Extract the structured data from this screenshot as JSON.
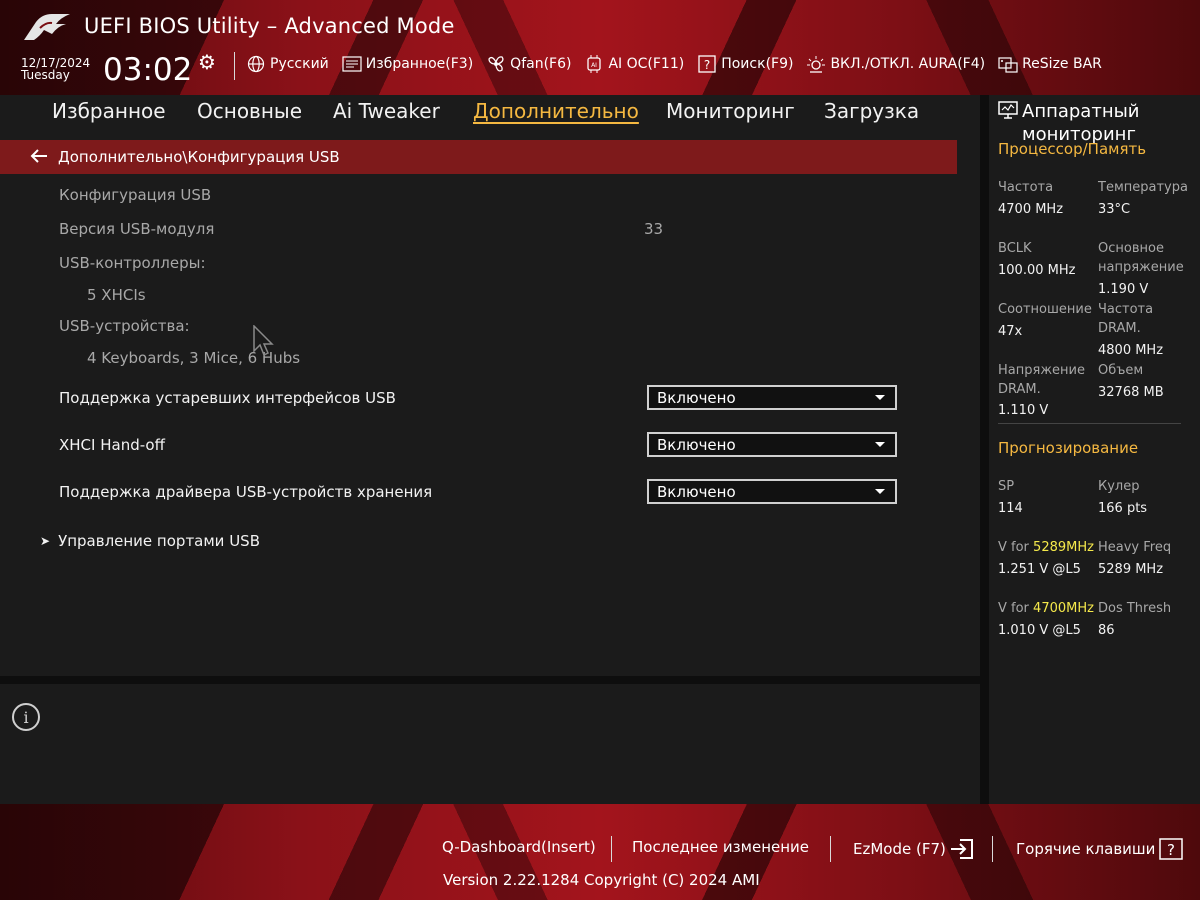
{
  "header": {
    "title": "UEFI BIOS Utility – Advanced Mode",
    "date": "12/17/2024",
    "weekday": "Tuesday",
    "time": "03:02",
    "toolbar": [
      {
        "label": "Русский",
        "icon": "globe-icon"
      },
      {
        "label": "Избранное(F3)",
        "icon": "favorites-icon"
      },
      {
        "label": "Qfan(F6)",
        "icon": "fan-icon"
      },
      {
        "label": "AI OC(F11)",
        "icon": "ai-chip-icon"
      },
      {
        "label": "Поиск(F9)",
        "icon": "search-help-icon"
      },
      {
        "label": "ВКЛ./ОТКЛ. AURA(F4)",
        "icon": "aura-light-icon"
      },
      {
        "label": "ReSize BAR",
        "icon": "resize-bar-icon"
      }
    ]
  },
  "tabs": [
    {
      "label": "Избранное",
      "active": false
    },
    {
      "label": "Основные",
      "active": false
    },
    {
      "label": "Ai Tweaker",
      "active": false
    },
    {
      "label": "Дополнительно",
      "active": true
    },
    {
      "label": "Мониторинг",
      "active": false
    },
    {
      "label": "Загрузка",
      "active": false
    }
  ],
  "main": {
    "breadcrumb": "Дополнительно\\Конфигурация USB",
    "section_title": "Конфигурация USB",
    "module_version_label": "Версия USB-модуля",
    "module_version_value": "33",
    "controllers_label": "USB-контроллеры:",
    "controllers_value": "5 XHCIs",
    "devices_label": "USB-устройства:",
    "devices_value": "4 Keyboards, 3 Mice, 6 Hubs",
    "settings": [
      {
        "label": "Поддержка устаревших интерфейсов USB",
        "value": "Включено"
      },
      {
        "label": "XHCI Hand-off",
        "value": "Включено"
      },
      {
        "label": "Поддержка драйвера USB-устройств хранения",
        "value": "Включено"
      }
    ],
    "submenu": "Управление портами USB"
  },
  "monitor": {
    "title": "Аппаратный мониторинг",
    "cpu_section": "Процессор/Память",
    "cpu": {
      "freq_label": "Частота",
      "freq_value": "4700 MHz",
      "temp_label": "Температура",
      "temp_value": "33°C",
      "bclk_label": "BCLK",
      "bclk_value": "100.00 MHz",
      "vcore_label": "Основное напряжение",
      "vcore_value": "1.190 V",
      "ratio_label": "Соотношение",
      "ratio_value": "47x",
      "dram_freq_label": "Частота DRAM.",
      "dram_freq_value": "4800 MHz",
      "dram_volt_label": "Напряжение DRAM.",
      "dram_volt_value": "1.110 V",
      "capacity_label": "Объем",
      "capacity_value": "32768 MB"
    },
    "prediction_section": "Прогнозирование",
    "prediction": {
      "sp_label": "SP",
      "sp_value": "114",
      "cooler_label": "Кулер",
      "cooler_value": "166 pts",
      "v1_prefix": "V for",
      "v1_freq": "5289MHz",
      "v1_value": "1.251 V @L5",
      "heavy_label": "Heavy Freq",
      "heavy_value": "5289 MHz",
      "v2_prefix": "V for",
      "v2_freq": "4700MHz",
      "v2_value": "1.010 V @L5",
      "dos_label": "Dos Thresh",
      "dos_value": "86"
    }
  },
  "footer": {
    "qdashboard": "Q-Dashboard(Insert)",
    "last_change": "Последнее изменение",
    "ezmode": "EzMode (F7)",
    "hotkeys": "Горячие клавиши",
    "copyright": "Version 2.22.1284 Copyright (C) 2024 AMI"
  },
  "colors": {
    "accent": "#f5b841",
    "brand_red": "#a3141c",
    "breadcrumb_bg": "#7e1a1b",
    "highlight_yellow": "#f5e94b"
  }
}
